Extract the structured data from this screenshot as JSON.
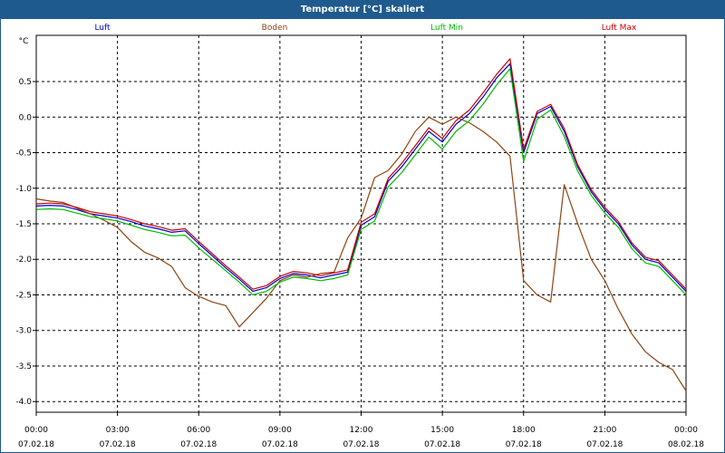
{
  "title": "Temperatur [°C] skaliert",
  "colors": {
    "titlebar_bg": "#1f5a8f",
    "titlebar_text": "#ffffff"
  },
  "chart_data": {
    "type": "line",
    "ylabel": "°C",
    "ylim": [
      -4.15,
      1.15
    ],
    "xlim": [
      "07.02.18 00:00",
      "08.02.18 00:00"
    ],
    "grid": true,
    "legend_placement": "top",
    "yticks": [
      "0.5",
      "0.0",
      "-0.5",
      "-1.0",
      "-1.5",
      "-2.0",
      "-2.5",
      "-3.0",
      "-3.5",
      "-4.0"
    ],
    "ytick_values": [
      0.5,
      0.0,
      -0.5,
      -1.0,
      -1.5,
      -2.0,
      -2.5,
      -3.0,
      -3.5,
      -4.0
    ],
    "xticks": [
      {
        "time": "00:00",
        "date": "07.02.18",
        "h": 0
      },
      {
        "time": "03:00",
        "date": "07.02.18",
        "h": 3
      },
      {
        "time": "06:00",
        "date": "07.02.18",
        "h": 6
      },
      {
        "time": "09:00",
        "date": "07.02.18",
        "h": 9
      },
      {
        "time": "12:00",
        "date": "07.02.18",
        "h": 12
      },
      {
        "time": "15:00",
        "date": "07.02.18",
        "h": 15
      },
      {
        "time": "18:00",
        "date": "07.02.18",
        "h": 18
      },
      {
        "time": "21:00",
        "date": "07.02.18",
        "h": 21
      },
      {
        "time": "00:00",
        "date": "08.02.18",
        "h": 24
      }
    ],
    "x_hours": [
      0,
      0.5,
      1,
      1.5,
      2,
      2.5,
      3,
      3.5,
      4,
      4.5,
      5,
      5.5,
      6,
      6.5,
      7,
      7.5,
      8,
      8.5,
      9,
      9.5,
      10,
      10.5,
      11,
      11.5,
      12,
      12.5,
      13,
      13.5,
      14,
      14.5,
      15,
      15.5,
      16,
      16.5,
      17,
      17.5,
      18,
      18.5,
      19,
      19.5,
      20,
      20.5,
      21,
      21.5,
      22,
      22.5,
      23,
      23.5,
      24
    ],
    "series": [
      {
        "name": "Luft",
        "color": "#0000cc",
        "values": [
          -1.25,
          -1.24,
          -1.25,
          -1.3,
          -1.36,
          -1.39,
          -1.42,
          -1.47,
          -1.53,
          -1.57,
          -1.62,
          -1.6,
          -1.78,
          -1.95,
          -2.12,
          -2.28,
          -2.45,
          -2.4,
          -2.27,
          -2.2,
          -2.22,
          -2.26,
          -2.22,
          -2.18,
          -1.52,
          -1.4,
          -0.9,
          -0.7,
          -0.45,
          -0.2,
          -0.35,
          -0.1,
          0.05,
          0.28,
          0.55,
          0.75,
          -0.5,
          0.05,
          0.15,
          -0.2,
          -0.7,
          -1.05,
          -1.3,
          -1.5,
          -1.8,
          -2.0,
          -2.05,
          -2.25,
          -2.45
        ]
      },
      {
        "name": "Boden",
        "color": "#8b4513",
        "values": [
          -1.15,
          -1.18,
          -1.2,
          -1.28,
          -1.36,
          -1.45,
          -1.55,
          -1.75,
          -1.9,
          -1.98,
          -2.1,
          -2.4,
          -2.52,
          -2.6,
          -2.65,
          -2.95,
          -2.75,
          -2.55,
          -2.3,
          -2.22,
          -2.25,
          -2.2,
          -2.18,
          -1.7,
          -1.42,
          -0.85,
          -0.75,
          -0.52,
          -0.2,
          0.0,
          -0.1,
          0.0,
          -0.08,
          -0.2,
          -0.35,
          -0.55,
          -2.3,
          -2.5,
          -2.6,
          -0.95,
          -1.5,
          -2.0,
          -2.3,
          -2.7,
          -3.05,
          -3.3,
          -3.45,
          -3.55,
          -3.85
        ]
      },
      {
        "name": "Luft Min",
        "color": "#00bb00",
        "values": [
          -1.3,
          -1.29,
          -1.3,
          -1.35,
          -1.4,
          -1.43,
          -1.46,
          -1.52,
          -1.58,
          -1.62,
          -1.67,
          -1.66,
          -1.84,
          -2.0,
          -2.16,
          -2.32,
          -2.5,
          -2.45,
          -2.32,
          -2.25,
          -2.27,
          -2.3,
          -2.27,
          -2.22,
          -1.58,
          -1.46,
          -0.98,
          -0.78,
          -0.53,
          -0.28,
          -0.45,
          -0.2,
          -0.05,
          0.18,
          0.45,
          0.68,
          -0.62,
          -0.03,
          0.1,
          -0.27,
          -0.76,
          -1.1,
          -1.35,
          -1.55,
          -1.85,
          -2.05,
          -2.1,
          -2.3,
          -2.5
        ]
      },
      {
        "name": "Luft Max",
        "color": "#cc0000",
        "values": [
          -1.22,
          -1.21,
          -1.22,
          -1.27,
          -1.33,
          -1.36,
          -1.39,
          -1.44,
          -1.5,
          -1.54,
          -1.59,
          -1.57,
          -1.75,
          -1.92,
          -2.09,
          -2.25,
          -2.42,
          -2.37,
          -2.24,
          -2.17,
          -2.19,
          -2.23,
          -2.19,
          -2.15,
          -1.48,
          -1.36,
          -0.86,
          -0.65,
          -0.4,
          -0.15,
          -0.3,
          -0.05,
          0.1,
          0.34,
          0.6,
          0.82,
          -0.45,
          0.08,
          0.18,
          -0.16,
          -0.67,
          -1.02,
          -1.27,
          -1.47,
          -1.77,
          -1.97,
          -2.02,
          -2.22,
          -2.42
        ]
      }
    ]
  }
}
